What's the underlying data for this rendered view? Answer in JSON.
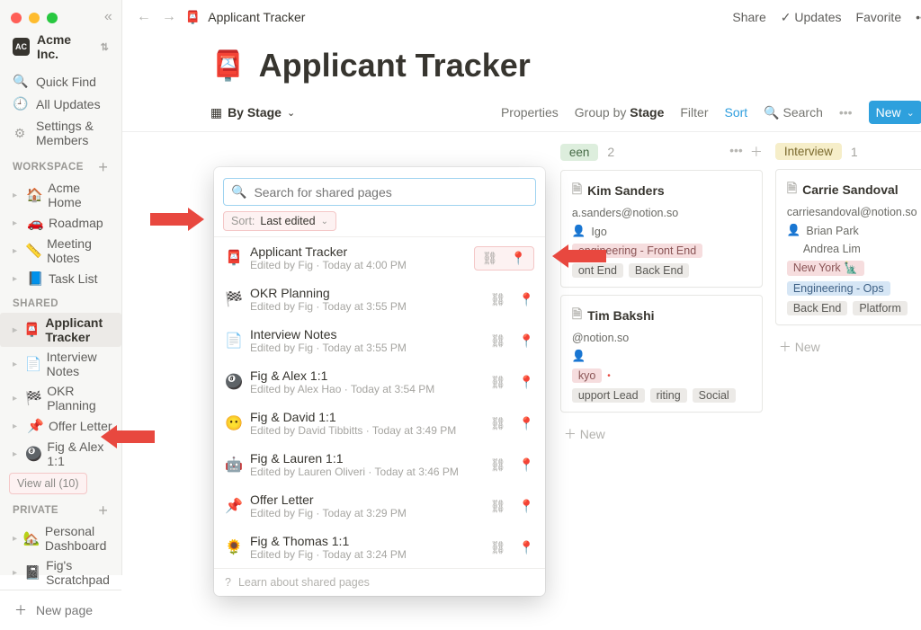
{
  "workspace": {
    "name": "Acme Inc."
  },
  "sidebar": {
    "quick_find": "Quick Find",
    "all_updates": "All Updates",
    "settings": "Settings & Members",
    "section_workspace": "WORKSPACE",
    "section_shared": "SHARED",
    "section_private": "PRIVATE",
    "workspace_pages": [
      {
        "emoji": "🏠",
        "label": "Acme Home"
      },
      {
        "emoji": "🚗",
        "label": "Roadmap"
      },
      {
        "emoji": "📏",
        "label": "Meeting Notes"
      },
      {
        "emoji": "📘",
        "label": "Task List"
      }
    ],
    "shared_pages": [
      {
        "emoji": "📮",
        "label": "Applicant Tracker"
      },
      {
        "emoji": "📄",
        "label": "Interview Notes"
      },
      {
        "emoji": "🏁",
        "label": "OKR Planning"
      },
      {
        "emoji": "📌",
        "label": "Offer Letter"
      },
      {
        "emoji": "🎱",
        "label": "Fig & Alex 1:1"
      }
    ],
    "view_all": "View all (10)",
    "private_pages": [
      {
        "emoji": "🏡",
        "label": "Personal Dashboard"
      },
      {
        "emoji": "📓",
        "label": "Fig's Scratchpad"
      }
    ],
    "new_page": "New page"
  },
  "header": {
    "breadcrumb_emoji": "📮",
    "breadcrumb": "Applicant Tracker",
    "share": "Share",
    "updates": "Updates",
    "favorite": "Favorite"
  },
  "page": {
    "title_emoji": "📮",
    "title": "Applicant Tracker"
  },
  "controls": {
    "view_label": "By Stage",
    "properties": "Properties",
    "group_by_prefix": "Group by",
    "group_by_value": "Stage",
    "filter": "Filter",
    "sort": "Sort",
    "search": "Search",
    "new": "New"
  },
  "board": {
    "col1": {
      "label": "een",
      "count": "2",
      "cards": [
        {
          "name": "Kim Sanders",
          "email": "a.sanders@notion.so",
          "assignee": "Igo",
          "loc": "engineering - Front End",
          "tags": [
            "ont End",
            "Back End"
          ]
        },
        {
          "name": "Tim Bakshi",
          "email": "@notion.so",
          "assignee": "",
          "loc": "kyo",
          "tags": [
            "upport Lead",
            "riting",
            "Social"
          ]
        }
      ],
      "new": "New"
    },
    "col2": {
      "label": "Interview",
      "count": "1",
      "cards": [
        {
          "name": "Carrie Sandoval",
          "email": "carriesandoval@notion.so",
          "assignee": "Brian Park",
          "assignee2": "Andrea Lim",
          "loc": "New York 🗽",
          "dept": "Engineering - Ops",
          "tags": [
            "Back End",
            "Platform"
          ]
        }
      ],
      "new": "New"
    }
  },
  "popup": {
    "search_placeholder": "Search for shared pages",
    "sort_label": "Sort:",
    "sort_value": "Last edited",
    "items": [
      {
        "emoji": "📮",
        "name": "Applicant Tracker",
        "sub": "Edited by Fig · Today at 4:00 PM"
      },
      {
        "emoji": "🏁",
        "name": "OKR Planning",
        "sub": "Edited by Fig · Today at 3:55 PM"
      },
      {
        "emoji": "📄",
        "name": "Interview Notes",
        "sub": "Edited by Fig · Today at 3:55 PM"
      },
      {
        "emoji": "🎱",
        "name": "Fig & Alex 1:1",
        "sub": "Edited by Alex Hao · Today at 3:54 PM"
      },
      {
        "emoji": "😶",
        "name": "Fig & David 1:1",
        "sub": "Edited by David Tibbitts · Today at 3:49 PM"
      },
      {
        "emoji": "🤖",
        "name": "Fig & Lauren 1:1",
        "sub": "Edited by Lauren Oliveri · Today at 3:46 PM"
      },
      {
        "emoji": "📌",
        "name": "Offer Letter",
        "sub": "Edited by Fig · Today at 3:29 PM"
      },
      {
        "emoji": "🌻",
        "name": "Fig & Thomas 1:1",
        "sub": "Edited by Fig · Today at 3:24 PM"
      }
    ],
    "footer": "Learn about shared pages"
  }
}
